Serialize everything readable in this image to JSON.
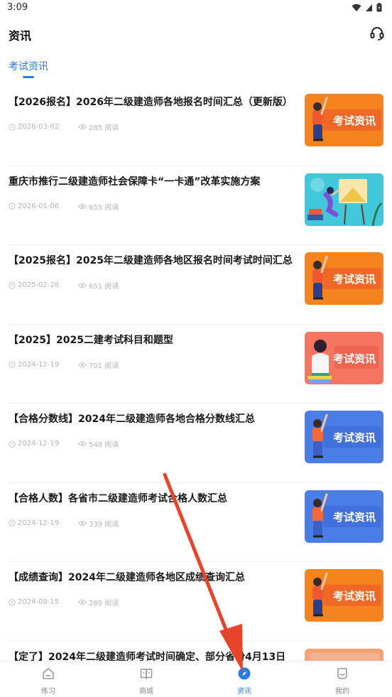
{
  "status_bar": {
    "time": "3:09"
  },
  "header": {
    "title": "资讯",
    "service_icon": "headset-icon"
  },
  "tabs": [
    {
      "label": "考试资讯",
      "active": true
    }
  ],
  "articles": [
    {
      "title": "【2026报名】2026年二级建造师各地报名时间汇总（更新版）",
      "date": "2026-03-02",
      "views": "285 阅读",
      "thumb_text": "考试资讯",
      "thumb_bg": "#f5841f",
      "thumb_style": "figure-orange"
    },
    {
      "title": "重庆市推行二级建造师社会保障卡“一卡通”改革实施方案",
      "date": "2026-01-06",
      "views": "655 阅读",
      "thumb_text": "",
      "thumb_bg": "#3cc5d8",
      "thumb_style": "painter"
    },
    {
      "title": "【2025报名】2025年二级建造师各地区报名时间考试时间汇总",
      "date": "2025-02-28",
      "views": "651 阅读",
      "thumb_text": "考试资讯",
      "thumb_bg": "#f5841f",
      "thumb_style": "figure-orange"
    },
    {
      "title": "【2025】2025二建考试科目和题型",
      "date": "2024-12-19",
      "views": "701 阅读",
      "thumb_text": "考试资讯",
      "thumb_bg": "#f47560",
      "thumb_style": "girl-books"
    },
    {
      "title": "【合格分数线】2024年二级建造师各地合格分数线汇总",
      "date": "2024-12-19",
      "views": "548 阅读",
      "thumb_text": "考试资讯",
      "thumb_bg": "#4a7de6",
      "thumb_style": "figure-blue"
    },
    {
      "title": "【合格人数】各省市二级建造师考试合格人数汇总",
      "date": "2024-12-19",
      "views": "339 阅读",
      "thumb_text": "考试资讯",
      "thumb_bg": "#4a7de6",
      "thumb_style": "figure-blue"
    },
    {
      "title": "【成绩查询】2024年二级建造师各地区成绩查询汇总",
      "date": "2024-08-15",
      "views": "289 阅读",
      "thumb_text": "考试资讯",
      "thumb_bg": "#f5841f",
      "thumb_style": "figure-orange"
    },
    {
      "title": "【定了】2024年二级建造师考试时间确定、部分省份4月13日",
      "date": "",
      "views": "",
      "thumb_text": "",
      "thumb_bg": "#f7a177",
      "thumb_style": "plain"
    }
  ],
  "bottom_nav": [
    {
      "label": "练习",
      "icon": "practice-icon",
      "active": false
    },
    {
      "label": "商城",
      "icon": "book-icon",
      "active": false
    },
    {
      "label": "资讯",
      "icon": "compass-icon",
      "active": true
    },
    {
      "label": "我的",
      "icon": "profile-icon",
      "active": false
    }
  ],
  "colors": {
    "accent": "#2a7be4",
    "annotation_arrow": "#e8432b"
  }
}
